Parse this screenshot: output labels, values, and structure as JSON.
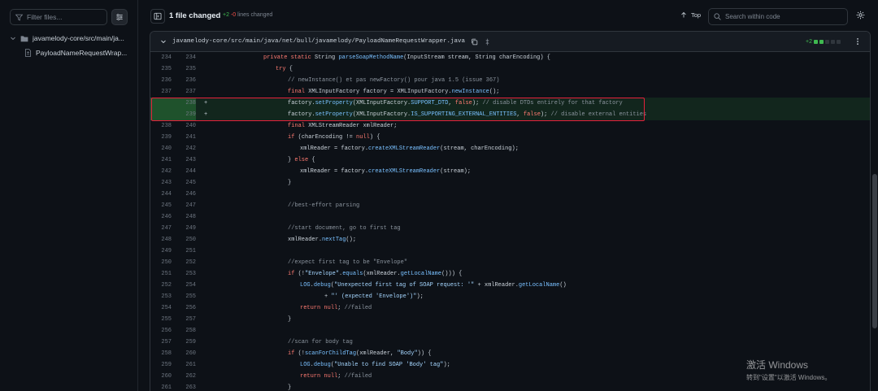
{
  "sidebar": {
    "filter_placeholder": "Filter files...",
    "folder": "javamelody-core/src/main/ja...",
    "file": "PayloadNameRequestWrap..."
  },
  "header": {
    "files_changed": "1 file changed",
    "additions": "+2",
    "deletions": "-0",
    "lines_changed_label": "lines changed",
    "top_label": "Top",
    "search_placeholder": "Search within code"
  },
  "file": {
    "path": "javamelody-core/src/main/java/net/bull/javamelody/PayloadNameRequestWrapper.java",
    "stat": "+2"
  },
  "colors": {
    "added_bg": "#1a3a26",
    "added_gutter": "#2a5a36",
    "highlight_border": "#e5213c",
    "add_green": "#3fb950"
  },
  "lines": [
    {
      "old": "234",
      "new": "234",
      "mark": "",
      "added": false,
      "indent": 3,
      "code": "private static String parseSoapMethodName(InputStream stream, String charEncoding) {"
    },
    {
      "old": "235",
      "new": "235",
      "mark": "",
      "added": false,
      "indent": 4,
      "code": "try {"
    },
    {
      "old": "236",
      "new": "236",
      "mark": "",
      "added": false,
      "indent": 5,
      "code": "// newInstance() et pas newFactory() pour java 1.5 (issue 367)"
    },
    {
      "old": "237",
      "new": "237",
      "mark": "",
      "added": false,
      "indent": 5,
      "code": "final XMLInputFactory factory = XMLInputFactory.newInstance();"
    },
    {
      "old": "",
      "new": "238",
      "mark": "+",
      "added": true,
      "indent": 5,
      "code": "factory.setProperty(XMLInputFactory.SUPPORT_DTD, false); // disable DTDs entirely for that factory"
    },
    {
      "old": "",
      "new": "239",
      "mark": "+",
      "added": true,
      "indent": 5,
      "code": "factory.setProperty(XMLInputFactory.IS_SUPPORTING_EXTERNAL_ENTITIES, false); // disable external entities"
    },
    {
      "old": "238",
      "new": "240",
      "mark": "",
      "added": false,
      "indent": 5,
      "code": "final XMLStreamReader xmlReader;"
    },
    {
      "old": "239",
      "new": "241",
      "mark": "",
      "added": false,
      "indent": 5,
      "code": "if (charEncoding != null) {"
    },
    {
      "old": "240",
      "new": "242",
      "mark": "",
      "added": false,
      "indent": 6,
      "code": "xmlReader = factory.createXMLStreamReader(stream, charEncoding);"
    },
    {
      "old": "241",
      "new": "243",
      "mark": "",
      "added": false,
      "indent": 5,
      "code": "} else {"
    },
    {
      "old": "242",
      "new": "244",
      "mark": "",
      "added": false,
      "indent": 6,
      "code": "xmlReader = factory.createXMLStreamReader(stream);"
    },
    {
      "old": "243",
      "new": "245",
      "mark": "",
      "added": false,
      "indent": 5,
      "code": "}"
    },
    {
      "old": "244",
      "new": "246",
      "mark": "",
      "added": false,
      "indent": 0,
      "code": ""
    },
    {
      "old": "245",
      "new": "247",
      "mark": "",
      "added": false,
      "indent": 5,
      "code": "//best-effort parsing"
    },
    {
      "old": "246",
      "new": "248",
      "mark": "",
      "added": false,
      "indent": 0,
      "code": ""
    },
    {
      "old": "247",
      "new": "249",
      "mark": "",
      "added": false,
      "indent": 5,
      "code": "//start document, go to first tag"
    },
    {
      "old": "248",
      "new": "250",
      "mark": "",
      "added": false,
      "indent": 5,
      "code": "xmlReader.nextTag();"
    },
    {
      "old": "249",
      "new": "251",
      "mark": "",
      "added": false,
      "indent": 0,
      "code": ""
    },
    {
      "old": "250",
      "new": "252",
      "mark": "",
      "added": false,
      "indent": 5,
      "code": "//expect first tag to be \"Envelope\""
    },
    {
      "old": "251",
      "new": "253",
      "mark": "",
      "added": false,
      "indent": 5,
      "code": "if (!\"Envelope\".equals(xmlReader.getLocalName())) {"
    },
    {
      "old": "252",
      "new": "254",
      "mark": "",
      "added": false,
      "indent": 6,
      "code": "LOG.debug(\"Unexpected first tag of SOAP request: '\" + xmlReader.getLocalName()"
    },
    {
      "old": "253",
      "new": "255",
      "mark": "",
      "added": false,
      "indent": 8,
      "code": "+ \"' (expected 'Envelope')\");"
    },
    {
      "old": "254",
      "new": "256",
      "mark": "",
      "added": false,
      "indent": 6,
      "code": "return null; //failed"
    },
    {
      "old": "255",
      "new": "257",
      "mark": "",
      "added": false,
      "indent": 5,
      "code": "}"
    },
    {
      "old": "256",
      "new": "258",
      "mark": "",
      "added": false,
      "indent": 0,
      "code": ""
    },
    {
      "old": "257",
      "new": "259",
      "mark": "",
      "added": false,
      "indent": 5,
      "code": "//scan for body tag"
    },
    {
      "old": "258",
      "new": "260",
      "mark": "",
      "added": false,
      "indent": 5,
      "code": "if (!scanForChildTag(xmlReader, \"Body\")) {"
    },
    {
      "old": "259",
      "new": "261",
      "mark": "",
      "added": false,
      "indent": 6,
      "code": "LOG.debug(\"Unable to find SOAP 'Body' tag\");"
    },
    {
      "old": "260",
      "new": "262",
      "mark": "",
      "added": false,
      "indent": 6,
      "code": "return null; //failed"
    },
    {
      "old": "261",
      "new": "263",
      "mark": "",
      "added": false,
      "indent": 5,
      "code": "}"
    }
  ],
  "watermark": {
    "line1": "激活 Windows",
    "line2": "转到\"设置\"以激活 Windows。"
  }
}
